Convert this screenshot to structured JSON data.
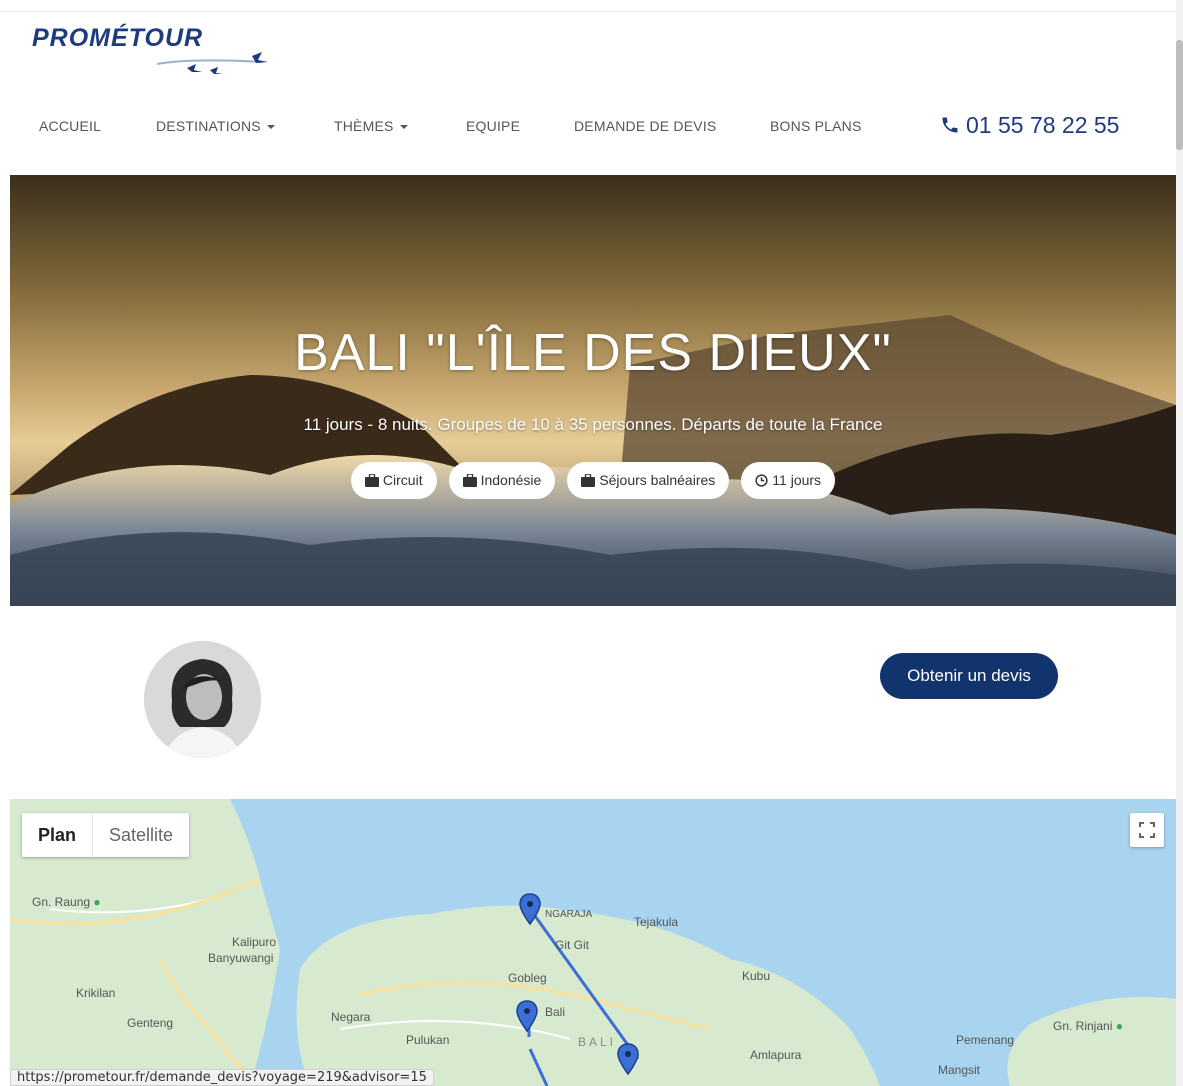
{
  "brand": {
    "logo_text": "PROMÉTOUR"
  },
  "nav": {
    "items": [
      {
        "label": "ACCUEIL"
      },
      {
        "label": "DESTINATIONS"
      },
      {
        "label": "THÈMES"
      },
      {
        "label": "EQUIPE"
      },
      {
        "label": "DEMANDE DE DEVIS"
      },
      {
        "label": "BONS PLANS"
      }
    ],
    "phone": "01 55 78 22 55"
  },
  "hero": {
    "title": "BALI \"L'ÎLE DES DIEUX\"",
    "subtitle": "11 jours - 8 nuits. Groupes de 10 à 35 personnes. Départs de toute la France",
    "tags": [
      {
        "label": "Circuit",
        "icon": "briefcase-icon"
      },
      {
        "label": "Indonésie",
        "icon": "briefcase-icon"
      },
      {
        "label": "Séjours balnéaires",
        "icon": "briefcase-icon"
      },
      {
        "label": "11 jours",
        "icon": "clock-icon"
      }
    ]
  },
  "advisor": {
    "quote_button": "Obtenir un devis"
  },
  "map": {
    "type_controls": {
      "plan": "Plan",
      "satellite": "Satellite"
    },
    "labels": [
      "Gn. Raung",
      "Kalipuro",
      "Banyuwangi",
      "Krikilan",
      "Genteng",
      "Negara",
      "Pulukan",
      "NGARAJA",
      "Tejakula",
      "Git Git",
      "Gobleg",
      "Kubu",
      "Bali",
      "BALI",
      "Amlapura",
      "Pemenang",
      "Gn. Rinjani",
      "Mangsit"
    ]
  },
  "status_bar": {
    "url": "https://prometour.fr/demande_devis?voyage=219&advisor=15"
  },
  "colors": {
    "brand_navy": "#11346e",
    "logo_blue": "#1d3b7e",
    "map_water": "#a9d4f0",
    "map_land": "#d7ead0",
    "route_blue": "#3b6fd6"
  }
}
